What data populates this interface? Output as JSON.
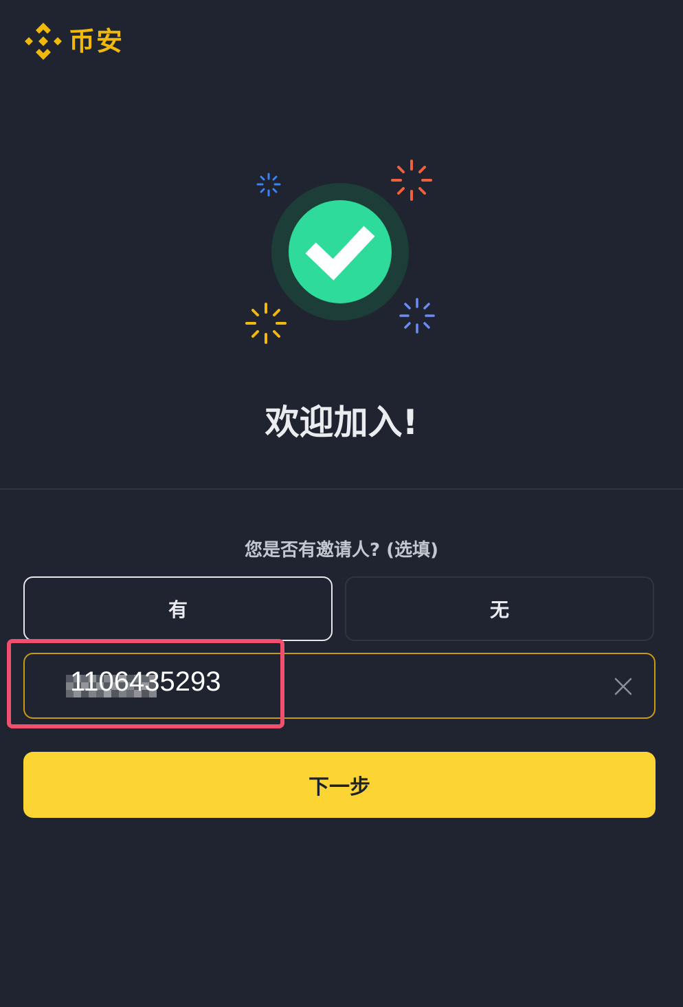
{
  "header": {
    "logo_text": "币安",
    "logo_icon": "binance-diamond-icon",
    "brand_color": "#f0b90b"
  },
  "hero": {
    "icon": "success-check-icon",
    "title": "欢迎加入!"
  },
  "referral": {
    "question": "您是否有邀请人? (选填)",
    "options": [
      {
        "label": "有",
        "selected": true
      },
      {
        "label": "无",
        "selected": false
      }
    ],
    "input_value": "1106435293",
    "clear_icon": "close-icon"
  },
  "actions": {
    "next_label": "下一步",
    "next_color": "#fcd535"
  },
  "annotation": {
    "highlight_color": "#f0506e"
  }
}
